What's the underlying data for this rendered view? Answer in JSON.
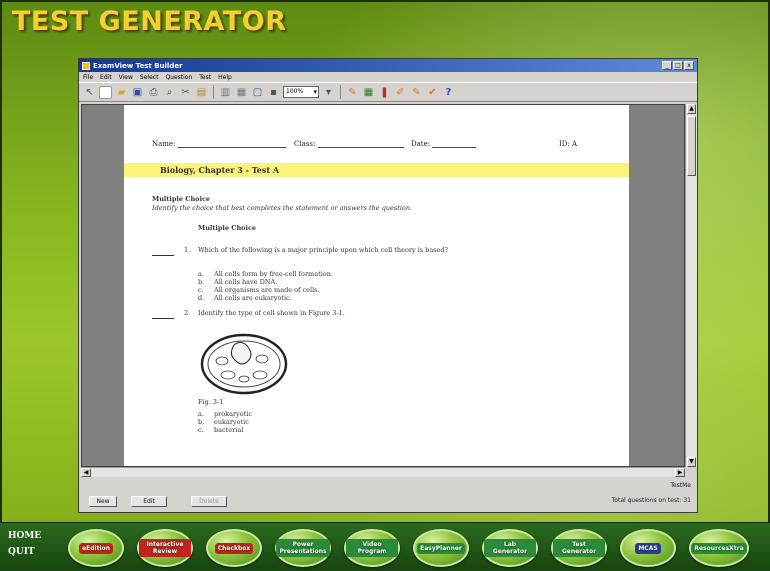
{
  "app": {
    "title": "TEST GENERATOR"
  },
  "window": {
    "title": "ExamView Test Builder",
    "menu": [
      "File",
      "Edit",
      "View",
      "Select",
      "Question",
      "Test",
      "Help"
    ],
    "zoom": "100%",
    "controls": [
      "_",
      "□",
      "x"
    ]
  },
  "document": {
    "name_label": "Name:",
    "class_label": "Class:",
    "date_label": "Date:",
    "id_label": "ID: A",
    "test_title": "Biology, Chapter 3 - Test A",
    "section_title": "Multiple Choice",
    "instructions": "Identify the choice that best completes the statement or answers the question.",
    "subsection": "Multiple Choice",
    "q1": {
      "number": "1.",
      "text": "Which of the following is a major principle upon which cell theory is based?",
      "choices": [
        {
          "letter": "a.",
          "text": "All cells form by free-cell formation."
        },
        {
          "letter": "b.",
          "text": "All cells have DNA."
        },
        {
          "letter": "c.",
          "text": "All organisms are made of cells."
        },
        {
          "letter": "d.",
          "text": "All cells are eukaryotic."
        }
      ]
    },
    "q2": {
      "number": "2.",
      "text": "Identify the type of cell shown in Figure 3-1.",
      "figure_caption": "Fig. 3-1",
      "choices": [
        {
          "letter": "a.",
          "text": "prokaryotic"
        },
        {
          "letter": "b.",
          "text": "eukaryotic"
        },
        {
          "letter": "c.",
          "text": "bacterial"
        }
      ]
    }
  },
  "status": {
    "mode": "TestMe",
    "count": "Total questions on test: 31"
  },
  "buttons": {
    "new": "New",
    "edit": "Edit",
    "delete": "Delete"
  },
  "nav": {
    "home": "HOME",
    "quit": "QUIT",
    "items": [
      {
        "label": "eEdition"
      },
      {
        "label": "Interactive Review"
      },
      {
        "label": "Checkbox"
      },
      {
        "label": "Power Presentations"
      },
      {
        "label": "Video Program"
      },
      {
        "label": "EasyPlanner"
      },
      {
        "label": "Lab Generator"
      },
      {
        "label": "Test Generator"
      },
      {
        "label": "MCAS"
      },
      {
        "label": "ResourcesXtra"
      }
    ]
  },
  "colors": {
    "title_yellow": "#f4d02c",
    "band_yellow": "#fbf47a",
    "frame_green": "#86b51f",
    "titlebar_blue": "#123a94"
  }
}
